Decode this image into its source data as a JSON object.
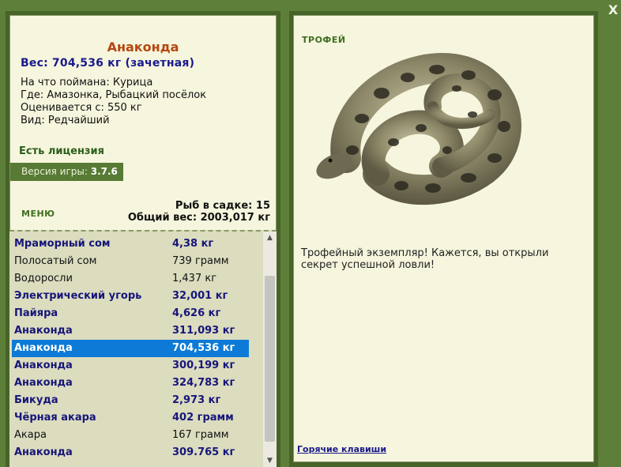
{
  "close_label": "X",
  "detail": {
    "name": "Анаконда",
    "weight": "Вес: 704,536 кг (зачетная)",
    "info": [
      "На что поймана: Курица",
      "Где: Амазонка, Рыбацкий посёлок",
      "Оценивается с: 550 кг",
      "Вид: Редчайший"
    ],
    "license": "Есть лицензия",
    "version_label": "Версия игры:",
    "version_value": "3.7.6"
  },
  "menu_label": "МЕНЮ",
  "keep": {
    "count": "Рыб в садке: 15",
    "total": "Общий вес: 2003,017 кг"
  },
  "fish_list": [
    {
      "name": "Мраморный сом",
      "weight": "4,38 кг",
      "bold": true
    },
    {
      "name": "Полосатый сом",
      "weight": "739 грамм",
      "bold": false
    },
    {
      "name": "Водоросли",
      "weight": "1,437 кг",
      "bold": false
    },
    {
      "name": "Электрический угорь",
      "weight": "32,001 кг",
      "bold": true
    },
    {
      "name": "Пайяра",
      "weight": "4,626 кг",
      "bold": true
    },
    {
      "name": "Анаконда",
      "weight": "311,093 кг",
      "bold": true
    },
    {
      "name": "Анаконда",
      "weight": "704,536 кг",
      "bold": true,
      "selected": true
    },
    {
      "name": "Анаконда",
      "weight": "300,199 кг",
      "bold": true
    },
    {
      "name": "Анаконда",
      "weight": "324,783 кг",
      "bold": true
    },
    {
      "name": "Бикуда",
      "weight": "2,973 кг",
      "bold": true
    },
    {
      "name": "Чёрная акара",
      "weight": "402 грамм",
      "bold": true
    },
    {
      "name": "Акара",
      "weight": "167 грамм",
      "bold": false
    },
    {
      "name": "Анаконда",
      "weight": "309.765 кг",
      "bold": true
    }
  ],
  "trophy": {
    "label": "ТРОФЕЙ",
    "description": "Трофейный экземпляр! Кажется, вы открыли секрет успешной ловли!",
    "hotkeys": "Горячие клавиши"
  },
  "colors": {
    "frame": "#476428",
    "panel_bg": "#f6f5dd",
    "list_bg": "#dcdcbf",
    "selection": "#0c7ad6",
    "name_color": "#b5470f",
    "bold_blue": "#16167a"
  }
}
